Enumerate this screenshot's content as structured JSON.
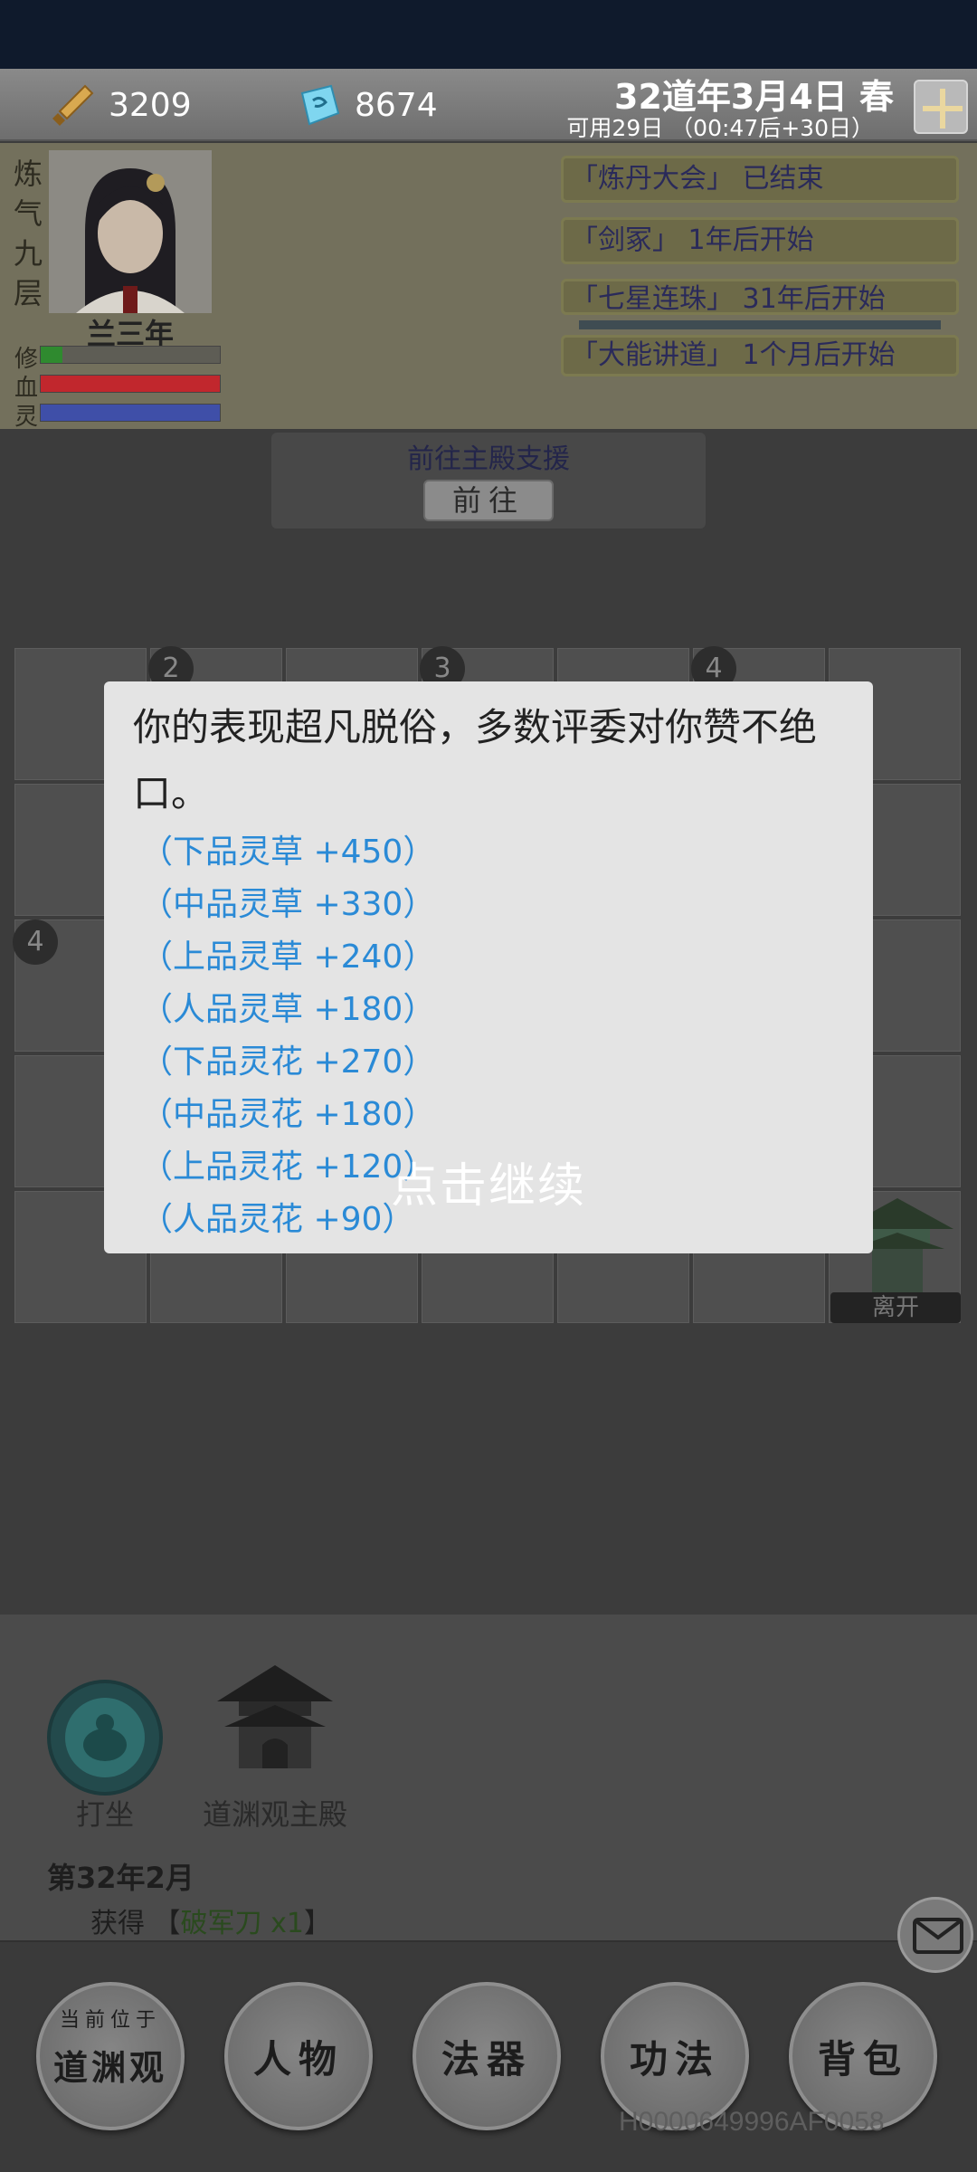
{
  "resources": {
    "coins": "3209",
    "spirit_stones": "8674"
  },
  "calendar": {
    "date": "32道年3月4日 春",
    "available": "可用29日 （00:47后+30日）"
  },
  "character": {
    "realm": [
      "炼",
      "气",
      "九",
      "层"
    ],
    "name": "兰三年",
    "stats": [
      {
        "label": "修",
        "value": 0.12,
        "color": "#2f8a2f"
      },
      {
        "label": "血",
        "value": 1.0,
        "color": "#c1272d"
      },
      {
        "label": "灵",
        "value": 1.0,
        "color": "#3f4fa8"
      }
    ]
  },
  "events": [
    "「炼丹大会」 已结束",
    "「剑冢」 1年后开始",
    "「七星连珠」 31年后开始",
    "「大能讲道」 1个月后开始"
  ],
  "support": {
    "title": "前往主殿支援",
    "button": "前往"
  },
  "map": {
    "markers": [
      "2",
      "3",
      "4",
      "4"
    ],
    "leave": "离开"
  },
  "actions": [
    {
      "label": "打坐"
    },
    {
      "label": "道渊观主殿"
    }
  ],
  "log": {
    "title": "第32年2月",
    "prefix": "获得 【",
    "item": "破军刀 x1",
    "suffix": "】"
  },
  "nav": {
    "location_top": "当前位于",
    "location": "道渊观",
    "character": "人物",
    "artifacts": "法器",
    "techniques": "功法",
    "backpack": "背包"
  },
  "device_id": "H0000649996AF0058",
  "dialog": {
    "message": "你的表现超凡脱俗，多数评委对你赞不绝口。",
    "rewards": [
      "（下品灵草 +450）",
      "（中品灵草 +330）",
      "（上品灵草 +240）",
      "（人品灵草 +180）",
      "（下品灵花 +270）",
      "（中品灵花 +180）",
      "（上品灵花 +120）",
      "（人品灵花 +90）"
    ],
    "continue_hint": "点击继续"
  },
  "colors": {
    "reward_text": "#2a8ad6",
    "overlay": "#3c3c3c",
    "dialog_bg": "#e4e4e4"
  }
}
